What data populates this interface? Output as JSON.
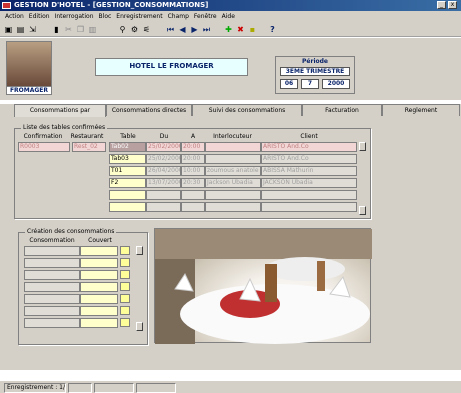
{
  "window": {
    "title": "GESTION D'HOTEL - [GESTION_CONSOMMATIONS]"
  },
  "menu": [
    "Action",
    "Edition",
    "Interrogation",
    "Bloc",
    "Enregistrement",
    "Champ",
    "Fenêtre",
    "Aide"
  ],
  "header": {
    "hotel_name": "HOTEL LE FROMAGER",
    "logo_label": "FROMAGER",
    "periode": {
      "label": "Période",
      "trimestre": "3EME TRIMESTRE",
      "day": "06",
      "month": "7",
      "year": "2000"
    }
  },
  "tabs": [
    "Consommations par reservation",
    "Consommations directes",
    "Suivi des consommations",
    "Facturation",
    "Reglement"
  ],
  "tables": {
    "group_label": "Liste des tables confirmées",
    "headers": [
      "Confirmation",
      "Restaurant",
      "Table",
      "Du",
      "A",
      "Interlocuteur",
      "Client"
    ],
    "confirmation": "R0003",
    "restaurant": "Rest_02",
    "rows": [
      {
        "table": "Tab02",
        "du": "25/02/2000",
        "a": "20:00",
        "interlocuteur": "",
        "client": "ARISTO And.Co"
      },
      {
        "table": "Tab03",
        "du": "25/02/2000",
        "a": "20:00",
        "interlocuteur": "",
        "client": "ARISTO And.Co"
      },
      {
        "table": "T01",
        "du": "26/04/2000",
        "a": "10:00",
        "interlocuteur": "zoumous anatole",
        "client": "ABISSA Mathurin"
      },
      {
        "table": "F2",
        "du": "13/07/2000",
        "a": "20:30",
        "interlocuteur": "Jackson Ubadia",
        "client": "JACKSON Ubadia"
      }
    ]
  },
  "creation": {
    "group_label": "Création des consommations",
    "headers": [
      "Consommation",
      "Couvert"
    ]
  },
  "status": {
    "text": "Enregistrement : 1/"
  }
}
